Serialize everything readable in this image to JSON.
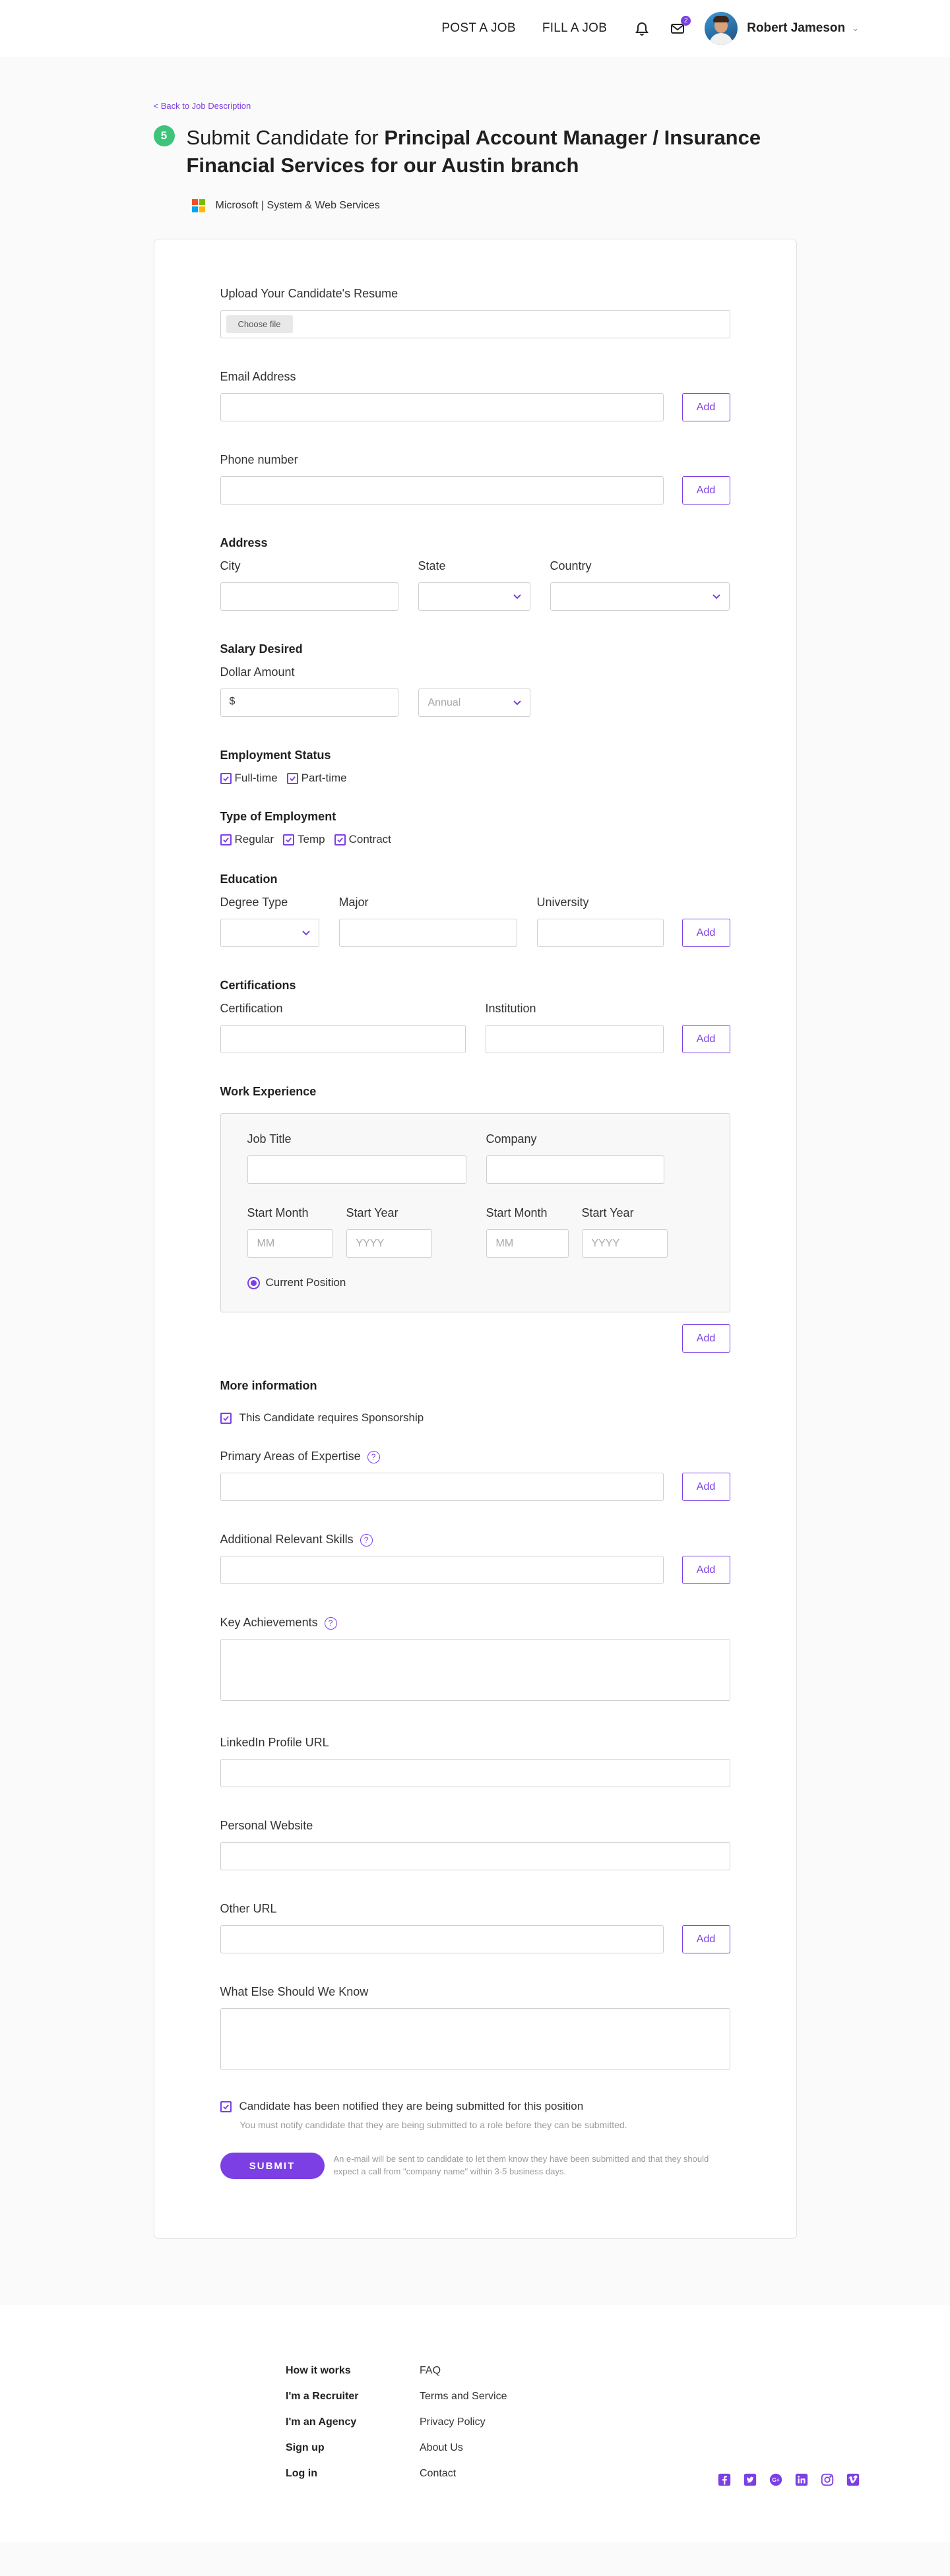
{
  "header": {
    "post_job": "POST A JOB",
    "fill_job": "FILL A JOB",
    "message_count": "2",
    "user_name": "Robert Jameson"
  },
  "page": {
    "back_link": "< Back to Job Description",
    "step": "5",
    "title_prefix": "Submit Candidate for ",
    "title_bold": "Principal Account Manager / Insurance Financial Services for our Austin branch",
    "company": "Microsoft | System & Web Services"
  },
  "form": {
    "resume_label": "Upload Your Candidate's Resume",
    "choose_file": "Choose file",
    "email_label": "Email Address",
    "phone_label": "Phone number",
    "add_label": "Add",
    "address_title": "Address",
    "city_label": "City",
    "state_label": "State",
    "country_label": "Country",
    "salary_title": "Salary Desired",
    "dollar_label": "Dollar Amount",
    "dollar_prefix": "$",
    "salary_period": "Annual",
    "employment_status_title": "Employment Status",
    "full_time": "Full-time",
    "part_time": "Part-time",
    "type_title": "Type of Employment",
    "regular": "Regular",
    "temp": "Temp",
    "contract": "Contract",
    "education_title": "Education",
    "degree_label": "Degree Type",
    "major_label": "Major",
    "university_label": "University",
    "certifications_title": "Certifications",
    "certification_label": "Certification",
    "institution_label": "Institution",
    "work_title": "Work Experience",
    "job_title_label": "Job Title",
    "company_label": "Company",
    "start_month_label": "Start Month",
    "start_year_label": "Start Year",
    "month_placeholder": "MM",
    "year_placeholder": "YYYY",
    "current_position": "Current Position",
    "more_title": "More information",
    "sponsorship": "This Candidate requires Sponsorship",
    "expertise_label": "Primary Areas of Expertise",
    "skills_label": "Additional Relevant Skills",
    "achievements_label": "Key Achievements",
    "help_glyph": "?",
    "linkedin_label": "LinkedIn Profile URL",
    "website_label": "Personal Website",
    "other_url_label": "Other URL",
    "else_label": "What Else Should We Know",
    "notified": "Candidate has been notified they are being submitted for this position",
    "notify_note": "You must notify candidate that they are being submitted to a role before they can be submitted.",
    "submit": "SUBMIT",
    "submit_note": "An e-mail will be sent to candidate to let them know they have been submitted and that they should expect a call from \"company name\" within 3-5 business days."
  },
  "footer": {
    "left": [
      "How it works",
      "I'm a Recruiter",
      "I'm an Agency",
      "Sign up",
      "Log in"
    ],
    "right": [
      "FAQ",
      "Terms and Service",
      "Privacy Policy",
      "About Us",
      "Contact"
    ],
    "social_icons": [
      "facebook-icon",
      "twitter-icon",
      "google-plus-icon",
      "linkedin-icon",
      "instagram-icon",
      "vimeo-icon"
    ]
  },
  "colors": {
    "accent": "#7b3fe4",
    "step_green": "#3ec37a"
  }
}
